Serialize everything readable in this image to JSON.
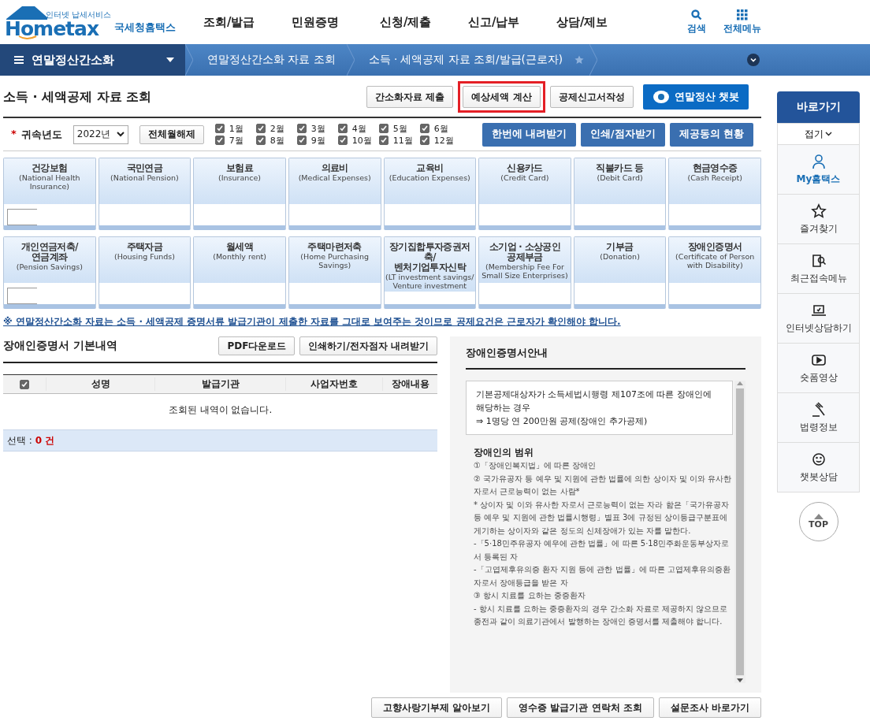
{
  "header": {
    "logo_tagline": "인터넷 납세서비스",
    "logo_text": "Hometax",
    "logo_korean": "국세청홈택스",
    "menu": [
      "조회/발급",
      "민원증명",
      "신청/제출",
      "신고/납부",
      "상담/제보"
    ],
    "tools": [
      {
        "kind": "search",
        "label": "검색"
      },
      {
        "kind": "grid",
        "label": "전체메뉴"
      }
    ]
  },
  "breadcrumb": {
    "section": "연말정산간소화",
    "items": [
      "연말정산간소화 자료 조회",
      "소득 · 세액공제 자료 조회/발급(근로자)"
    ],
    "favorite": false
  },
  "page_title": "소득 · 세액공제 자료 조회",
  "top_buttons": [
    {
      "kind": "plain",
      "label": "간소화자료 제출",
      "highlighted": false
    },
    {
      "kind": "plain",
      "label": "예상세액 계산",
      "highlighted": true
    },
    {
      "kind": "plain",
      "label": "공제신고서작성",
      "highlighted": false
    },
    {
      "kind": "chatbot",
      "label": "연말정산 챗봇",
      "highlighted": false
    }
  ],
  "filter": {
    "required_mark": "*",
    "label": "귀속년도",
    "year": "2022년",
    "clear_button": "전체월해제",
    "months": [
      {
        "label": "1월",
        "checked": true
      },
      {
        "label": "2월",
        "checked": true
      },
      {
        "label": "3월",
        "checked": true
      },
      {
        "label": "4월",
        "checked": true
      },
      {
        "label": "5월",
        "checked": true
      },
      {
        "label": "6월",
        "checked": true
      },
      {
        "label": "7월",
        "checked": true
      },
      {
        "label": "8월",
        "checked": true
      },
      {
        "label": "9월",
        "checked": true
      },
      {
        "label": "10월",
        "checked": true
      },
      {
        "label": "11월",
        "checked": true
      },
      {
        "label": "12월",
        "checked": true
      }
    ],
    "actions": [
      "한번에 내려받기",
      "인쇄/점자받기",
      "제공동의 현황"
    ]
  },
  "categories": [
    [
      {
        "title": "건강보험",
        "subtitle": "(National Health Insurance)"
      },
      {
        "title": "국민연금",
        "subtitle": "(National Pension)"
      },
      {
        "title": "보험료",
        "subtitle": "(Insurance)"
      },
      {
        "title": "의료비",
        "subtitle": "(Medical Expenses)"
      },
      {
        "title": "교육비",
        "subtitle": "(Education Expenses)"
      },
      {
        "title": "신용카드",
        "subtitle": "(Credit Card)"
      },
      {
        "title": "직불카드 등",
        "subtitle": "(Debit Card)"
      },
      {
        "title": "현금영수증",
        "subtitle": "(Cash Receipt)"
      }
    ],
    [
      {
        "title": "개인연금저축/\n연금계좌",
        "subtitle": "(Pension Savings)"
      },
      {
        "title": "주택자금",
        "subtitle": "(Housing Funds)"
      },
      {
        "title": "월세액",
        "subtitle": "(Monthly rent)"
      },
      {
        "title": "주택마련저축",
        "subtitle": "(Home Purchasing Savings)"
      },
      {
        "title": "장기집합투자증권저축/\n벤처기업투자신탁",
        "subtitle": "(LT investment savings/ Venture investment"
      },
      {
        "title": "소기업 · 소상공인\n공제부금",
        "subtitle": "(Membership Fee For Small Size Enterprises)"
      },
      {
        "title": "기부금",
        "subtitle": "(Donation)"
      },
      {
        "title": "장애인증명서",
        "subtitle": "(Certificate of Person with Disability)"
      }
    ]
  ],
  "notice": "※ 연말정산간소화 자료는 소득 · 세액공제 증명서류 발급기관이 제출한 자료를 그대로 보여주는 것이므로 공제요건은 근로자가 확인해야 합니다.",
  "detail": {
    "title": "장애인증명서 기본내역",
    "buttons": [
      "PDF다운로드",
      "인쇄하기/전자점자 내려받기"
    ],
    "select_all": true,
    "columns": [
      "성명",
      "발급기관",
      "사업자번호",
      "장애내용"
    ],
    "empty": "조회된 내역이 없습니다.",
    "selection_label": "선택 :",
    "selection_count": "0 건"
  },
  "guide": {
    "title": "장애인증명서안내",
    "box": [
      "기본공제대상자가 소득세법시행령 제107조에 따른 장애인에 해당하는 경우",
      "⇒ 1명당 연 200만원 공제(장애인 추가공제)"
    ],
    "heading": "장애인의 범위",
    "lines": [
      "①「장애인복지법」에 따른 장애인",
      "② 국가유공자 등 예우 및 지원에 관한 법률에 의한 상이자 및 이와 유사한 자로서 근로능력이 없는 사람*",
      "* 상이자 및 이와 유사한 자로서 근로능력이 없는 자라 함은「국가유공자 등 예우 및 지원에 관한 법률시행령」별표 3에 규정된 상이등급구분표에 게기하는 상이자와 같은 정도의 신체장애가 있는 자를 말한다.",
      "-「5·18민주유공자 예우에 관한 법률」에 따른 5·18민주화운동부상자로서 등록된 자",
      "-「고엽제후유의증 환자 지원 등에 관한 법률」에 따른 고엽제후유의증환자로서 장애등급을 받은 자",
      "③ 항시 치료를 요하는 중증환자",
      "- 항시 치료를 요하는 중증환자의 경우 간소화 자료로 제공하지 않으므로 종전과 같이 의료기관에서 발행하는 장애인 증명서를 제출해야 합니다."
    ]
  },
  "bottom_buttons": [
    "고향사랑기부제 알아보기",
    "영수증 발급기관 연락처 조회",
    "설문조사 바로가기"
  ],
  "quick": {
    "title": "바로가기",
    "fold": "접기",
    "items": [
      {
        "kind": "user",
        "label": "My홈택스",
        "selected": true
      },
      {
        "kind": "star",
        "label": "즐겨찾기",
        "selected": false
      },
      {
        "kind": "recent",
        "label": "최근접속메뉴",
        "selected": false
      },
      {
        "kind": "laptop",
        "label": "인터넷상담하기",
        "selected": false
      },
      {
        "kind": "video",
        "label": "숏폼영상",
        "selected": false
      },
      {
        "kind": "gavel",
        "label": "법령정보",
        "selected": false
      },
      {
        "kind": "chat",
        "label": "챗봇상담",
        "selected": false
      }
    ],
    "top": "TOP"
  }
}
